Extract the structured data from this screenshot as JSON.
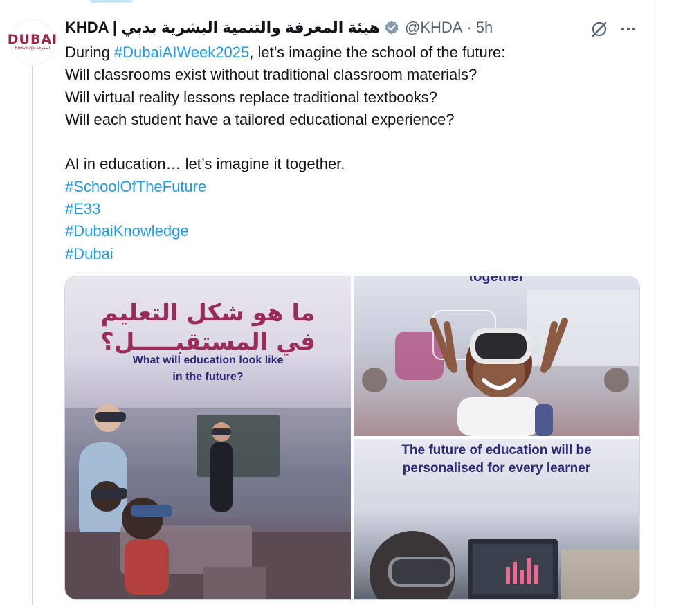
{
  "post": {
    "display_name": "KHDA | هيئة المعرفة والتنمية البشرية بدبي",
    "handle": "@KHDA",
    "separator": "·",
    "time": "5h",
    "avatar": {
      "logo_text": "DUBAI",
      "logo_subtext": "Knowledge المعرفة"
    },
    "lines": [
      {
        "parts": [
          {
            "text": "During ",
            "hashtag": false
          },
          {
            "text": "#DubaiAIWeek2025",
            "hashtag": true
          },
          {
            "text": ", let’s imagine the school of the future:",
            "hashtag": false
          }
        ]
      },
      {
        "parts": [
          {
            "text": "Will classrooms exist without traditional classroom materials?",
            "hashtag": false
          }
        ]
      },
      {
        "parts": [
          {
            "text": "Will virtual reality lessons replace traditional textbooks?",
            "hashtag": false
          }
        ]
      },
      {
        "parts": [
          {
            "text": "Will each student have a tailored educational experience?",
            "hashtag": false
          }
        ]
      },
      {
        "parts": [
          {
            "text": "",
            "hashtag": false
          }
        ]
      },
      {
        "parts": [
          {
            "text": "AI in education… let’s imagine it together.",
            "hashtag": false
          }
        ]
      },
      {
        "parts": [
          {
            "text": "#SchoolOfTheFuture",
            "hashtag": true
          }
        ]
      },
      {
        "parts": [
          {
            "text": "#E33",
            "hashtag": true
          }
        ]
      },
      {
        "parts": [
          {
            "text": "#DubaiKnowledge",
            "hashtag": true
          }
        ]
      },
      {
        "parts": [
          {
            "text": "#Dubai",
            "hashtag": true
          }
        ]
      }
    ]
  },
  "media": {
    "image1": {
      "arabic_line1": "ما هو شكل التعليم",
      "arabic_line2": "في المستقبـــــل؟",
      "english_line1": "What will education look like",
      "english_line2": "in the future?"
    },
    "image2": {
      "caption": "together"
    },
    "image3": {
      "caption_line1": "The future of education will be",
      "caption_line2": "personalised for every learner"
    }
  },
  "icons": {
    "verified": "verified-badge-icon",
    "grok": "grok-icon",
    "more": "more-icon"
  },
  "colors": {
    "hashtag": "#1d9bf0",
    "secondary_text": "#536471",
    "brand": "#9d2345",
    "caption_navy": "#2f2a78"
  }
}
